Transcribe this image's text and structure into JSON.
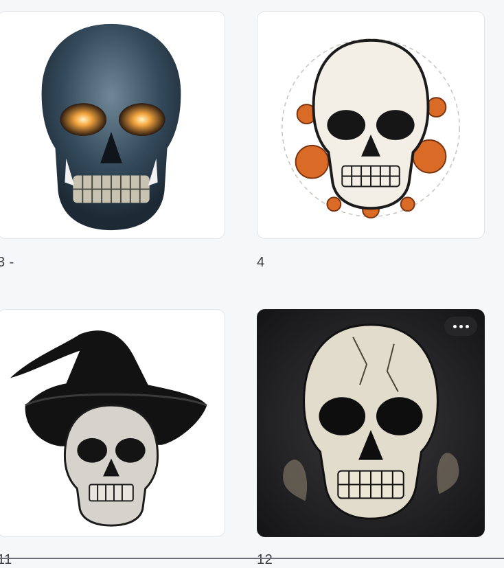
{
  "gallery": {
    "items": [
      {
        "caption": "3 -",
        "image": "blue-skull-glowing-eyes"
      },
      {
        "caption": "4",
        "image": "skull-with-orange-roses"
      },
      {
        "caption": "11",
        "image": "skull-with-witch-hat"
      },
      {
        "caption": "12",
        "image": "cracked-skull-dark-background"
      }
    ],
    "more_button": "more-options-icon"
  }
}
